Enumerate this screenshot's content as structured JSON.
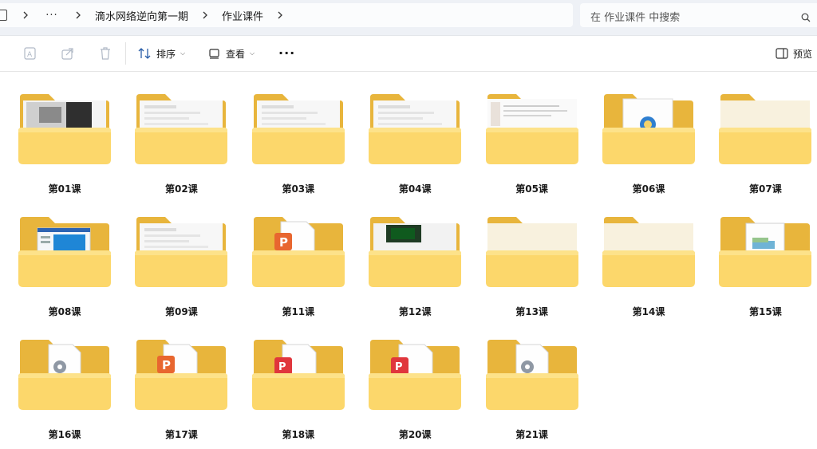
{
  "breadcrumb": {
    "ellipsis": "···",
    "items": [
      "滴水网络逆向第一期",
      "作业课件"
    ]
  },
  "search": {
    "placeholder": "在 作业课件 中搜索"
  },
  "toolbar": {
    "sort_label": "排序",
    "view_label": "查看",
    "more_label": "···",
    "preview_label": "预览"
  },
  "folders": [
    {
      "name": "第01课",
      "content": "photo-dark"
    },
    {
      "name": "第02课",
      "content": "doc-light"
    },
    {
      "name": "第03课",
      "content": "doc-light"
    },
    {
      "name": "第04课",
      "content": "doc-light"
    },
    {
      "name": "第05课",
      "content": "doc-screenshot"
    },
    {
      "name": "第06课",
      "content": "globe-file"
    },
    {
      "name": "第07课",
      "content": "empty"
    },
    {
      "name": "第08课",
      "content": "window-blue"
    },
    {
      "name": "第09课",
      "content": "doc-light"
    },
    {
      "name": "第11课",
      "content": "ppt-file"
    },
    {
      "name": "第12课",
      "content": "photo-green"
    },
    {
      "name": "第13课",
      "content": "empty"
    },
    {
      "name": "第14课",
      "content": "empty"
    },
    {
      "name": "第15课",
      "content": "image-file"
    },
    {
      "name": "第16课",
      "content": "settings-file"
    },
    {
      "name": "第17课",
      "content": "ppt-file"
    },
    {
      "name": "第18课",
      "content": "wps-file"
    },
    {
      "name": "第20课",
      "content": "wps-file"
    },
    {
      "name": "第21课",
      "content": "settings-file"
    }
  ],
  "colors": {
    "folder_back": "#e8b53c",
    "folder_front": "#fcd76b",
    "folder_tab": "#f2c04a",
    "accent": "#0067c0"
  }
}
